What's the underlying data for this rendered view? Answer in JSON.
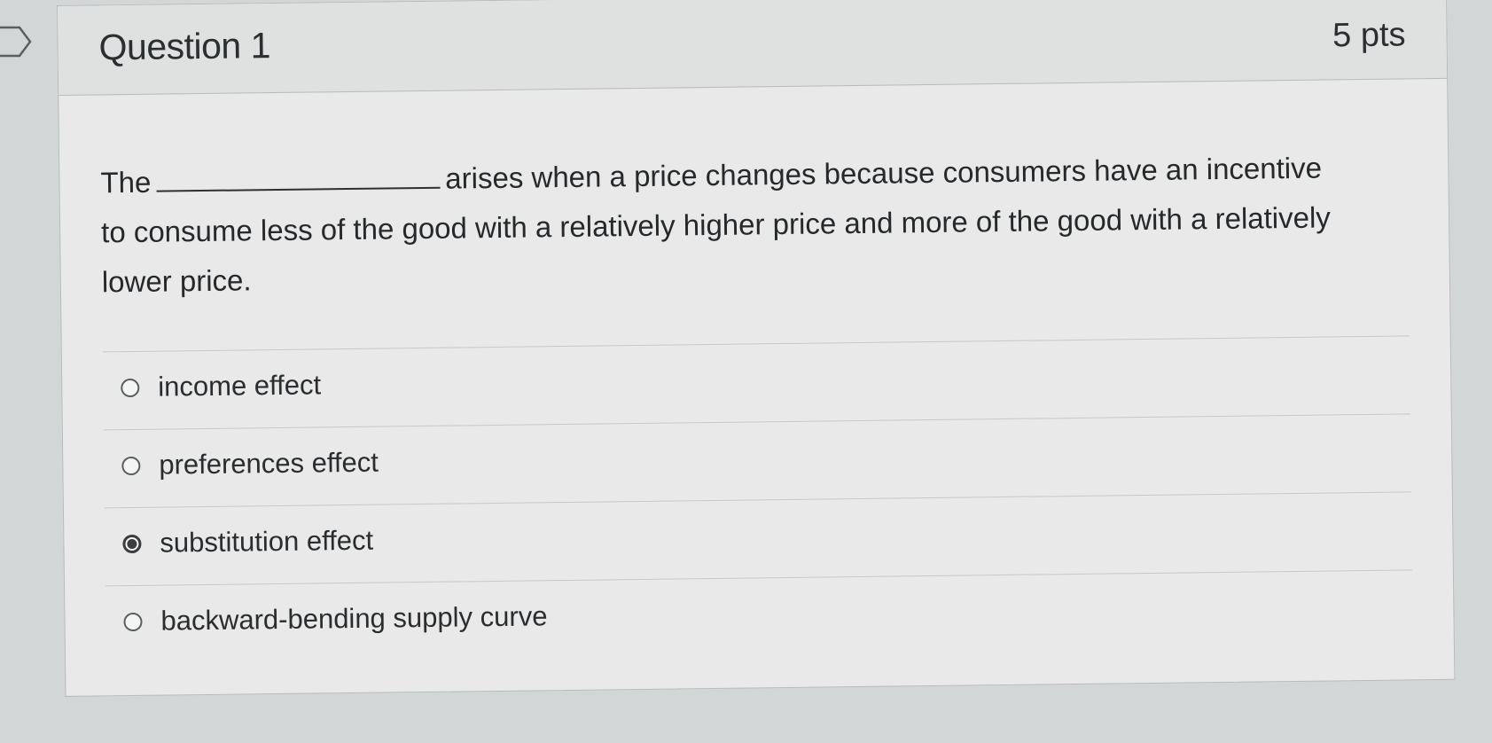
{
  "question": {
    "title": "Question 1",
    "points": "5 pts",
    "text_before": "The",
    "text_after": "arises when a price changes because consumers have an incentive to consume less of the good with a relatively higher price and more of the good with a relatively lower price."
  },
  "answers": [
    {
      "label": "income effect",
      "selected": false
    },
    {
      "label": "preferences effect",
      "selected": false
    },
    {
      "label": "substitution effect",
      "selected": true
    },
    {
      "label": "backward-bending supply curve",
      "selected": false
    }
  ],
  "colors": {
    "background": "#d3d6d6",
    "card": "#e8e9e8",
    "text": "#2a2d2f"
  }
}
